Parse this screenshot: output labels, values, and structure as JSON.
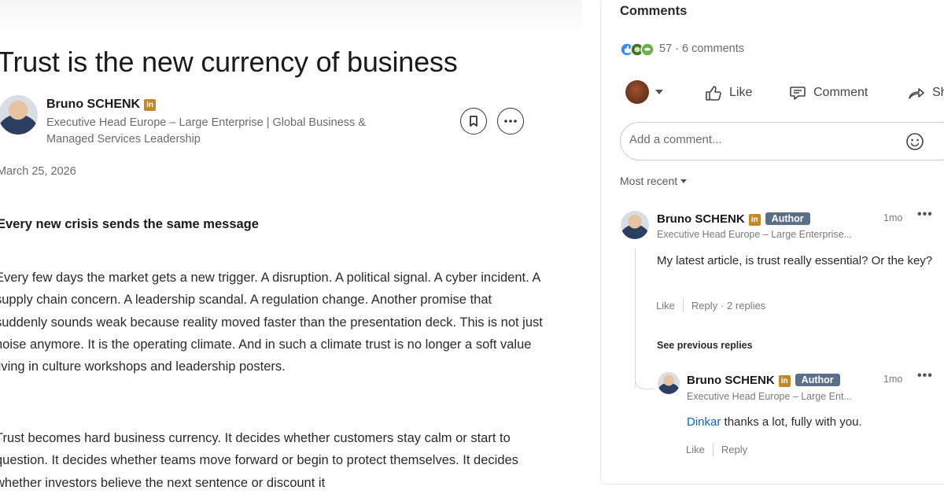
{
  "article": {
    "title": "Trust is the new currency of business",
    "author": {
      "name": "Bruno SCHENK",
      "badge": "in",
      "headline": "Executive Head Europe – Large Enterprise | Global Business & Managed Services Leadership"
    },
    "date": "March 25, 2026",
    "subheading": "Every new crisis sends the same message",
    "paragraphs": [
      "Every few days the market gets a new trigger. A disruption. A political signal. A cyber incident. A supply chain concern. A leadership scandal. A regulation change. Another promise that suddenly sounds weak because reality moved faster than the presentation deck. This is not just noise anymore. It is the operating climate. And in such a climate trust is no longer a soft value living in culture workshops and leadership posters.",
      "Trust becomes hard business currency. It decides whether customers stay calm or start to question. It decides whether teams move forward or begin to protect themselves. It decides whether investors believe the next sentence or discount it"
    ]
  },
  "comments_panel": {
    "title": "Comments",
    "reactions_count": "57",
    "comments_count": "· 6 comments",
    "actions": {
      "like": "Like",
      "comment": "Comment",
      "share": "Share"
    },
    "input_placeholder": "Add a comment...",
    "sort_label": "Most recent",
    "see_previous": "See previous replies",
    "comments": [
      {
        "name": "Bruno SCHENK",
        "badge": "in",
        "tag": "Author",
        "headline": "Executive Head Europe – Large Enterprise...",
        "time": "1mo",
        "text": "My latest article, is trust really essential? Or the key?",
        "like": "Like",
        "reply": "Reply",
        "replies": "· 2 replies"
      },
      {
        "name": "Bruno SCHENK",
        "badge": "in",
        "tag": "Author",
        "headline": "Executive Head Europe – Large Ent...",
        "time": "1mo",
        "mention": "Dinkar",
        "text": " thanks a lot, fully with you.",
        "like": "Like",
        "reply": "Reply"
      }
    ]
  },
  "colors": {
    "link": "#0a66c2",
    "author_tag": "#5b6f88",
    "linkedin_badge": "#c08a2a"
  },
  "icons": [
    "bookmark-icon",
    "more-icon",
    "reaction-like-icon",
    "reaction-celebrate-icon",
    "reaction-support-icon",
    "thumbs-up-icon",
    "comment-icon",
    "share-icon",
    "emoji-icon"
  ]
}
